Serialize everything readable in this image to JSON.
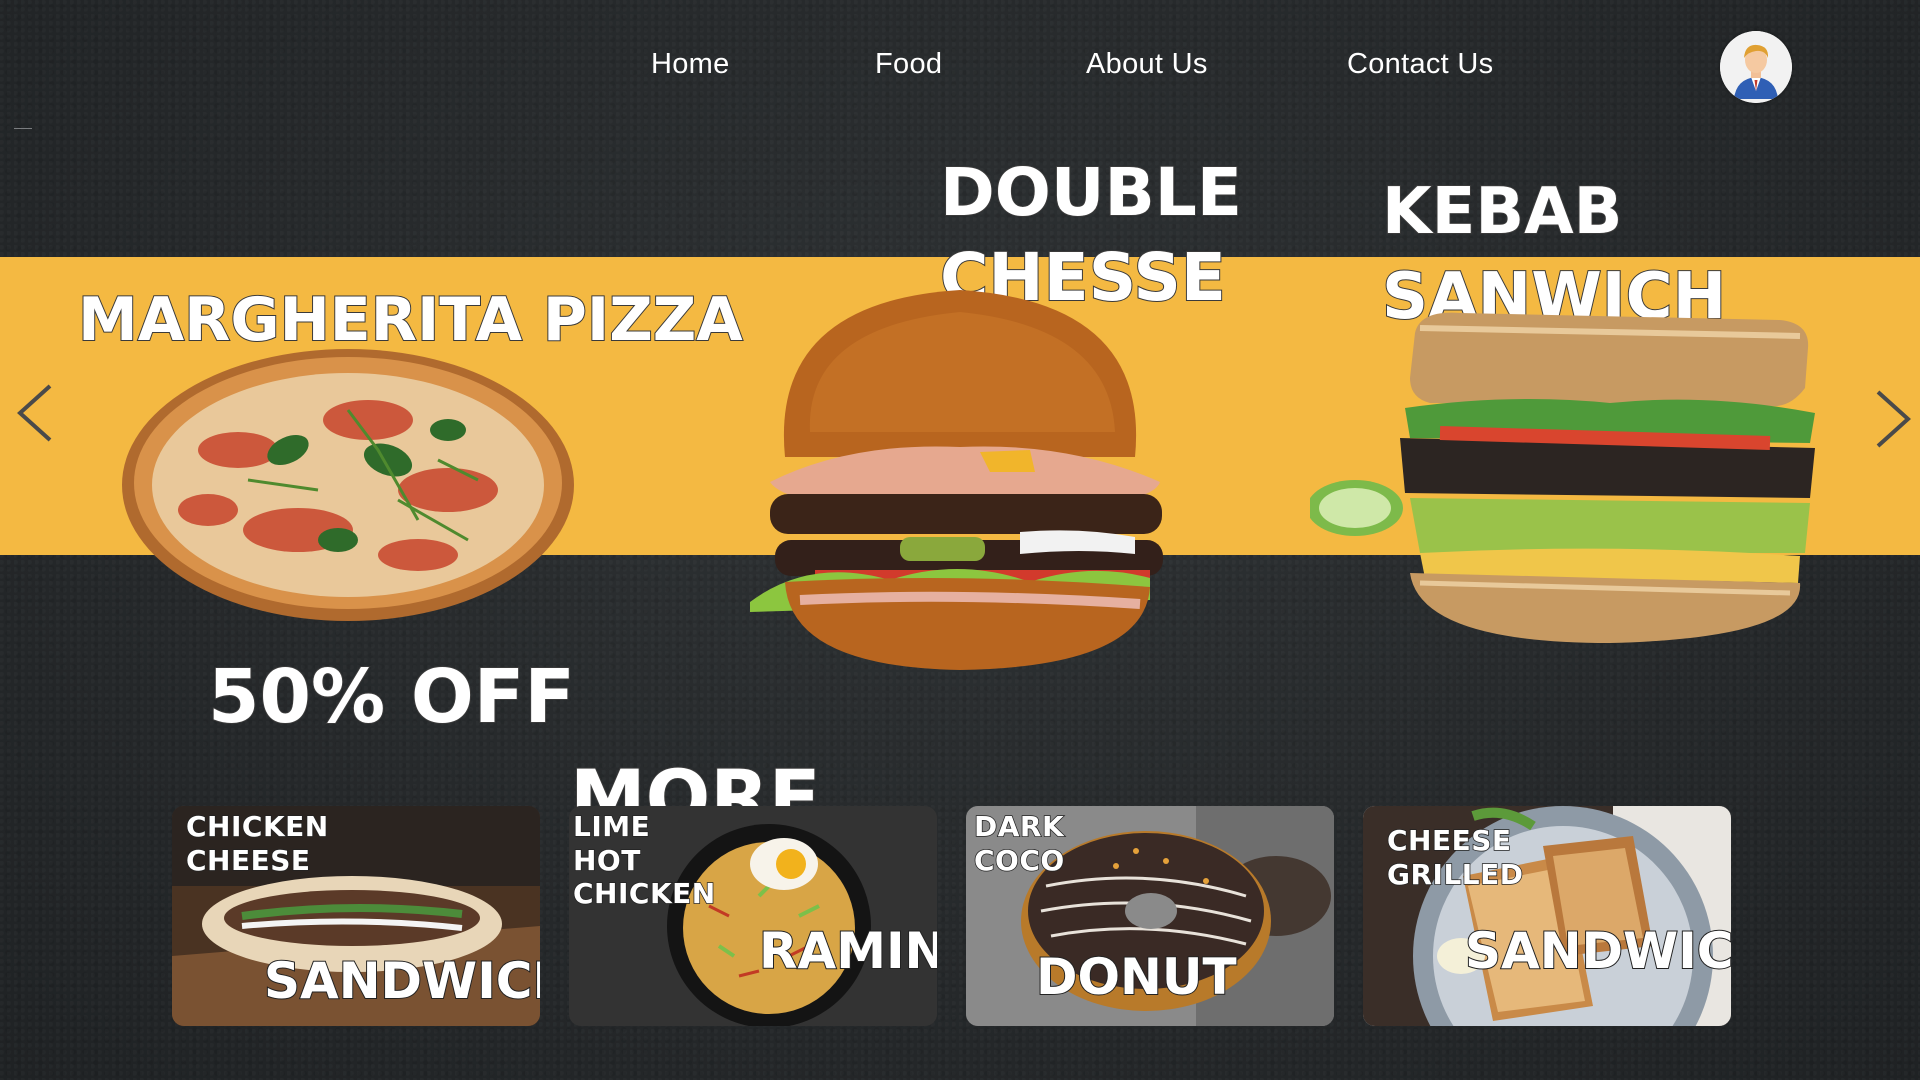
{
  "nav": {
    "home": "Home",
    "food": "Food",
    "about": "About Us",
    "contact": "Contact Us"
  },
  "colors": {
    "band": "#f4b942",
    "background": "#26292b",
    "text": "#ffffff"
  },
  "hero": {
    "pizza_title": "MARGHERITA PIZZA",
    "burger_title_1": "DOUBLE",
    "burger_title_2": "CHESSE",
    "kebab_title_1": "KEBAB",
    "kebab_title_2": "SANWICH",
    "discount": "50% OFF",
    "more": "MORE"
  },
  "cards": [
    {
      "small": "CHICKEN\nCHEESE",
      "big": "SANDWICH",
      "icon": "chicken-sandwich-image"
    },
    {
      "small": "LIME\nHOT\nCHICKEN",
      "big": "RAMIN",
      "icon": "ramen-bowl-image"
    },
    {
      "small": "DARK\nCOCO",
      "big": "DONUT",
      "icon": "donut-image"
    },
    {
      "small": "CHEESE\nGRILLED",
      "big": "SANDWICH",
      "icon": "grilled-sandwich-image"
    }
  ],
  "icons": {
    "prev": "chevron-left-icon",
    "next": "chevron-right-icon",
    "user": "user-avatar-icon"
  }
}
